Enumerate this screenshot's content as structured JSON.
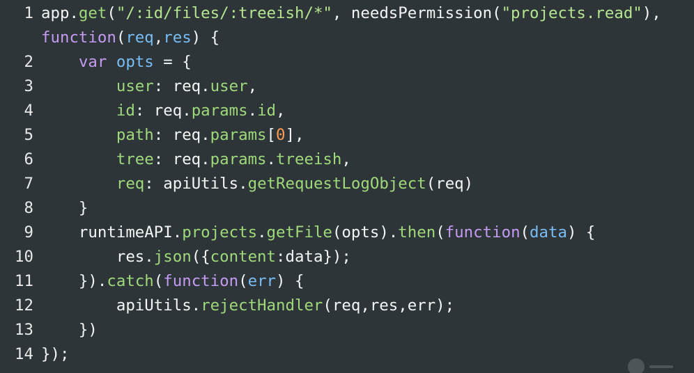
{
  "editor": {
    "lines": [
      {
        "number": "1",
        "tokens": [
          {
            "text": "app.",
            "kind": "plain"
          },
          {
            "text": "get",
            "kind": "prop"
          },
          {
            "text": "(",
            "kind": "plain"
          },
          {
            "text": "\"/:id/files/:treeish/*\"",
            "kind": "str"
          },
          {
            "text": ", needsPermission(",
            "kind": "plain"
          },
          {
            "text": "\"projects.read\"",
            "kind": "str"
          },
          {
            "text": "),",
            "kind": "plain"
          }
        ]
      },
      {
        "number": "",
        "tokens": [
          {
            "text": "function",
            "kind": "kw"
          },
          {
            "text": "(",
            "kind": "plain"
          },
          {
            "text": "req",
            "kind": "var"
          },
          {
            "text": ",",
            "kind": "plain"
          },
          {
            "text": "res",
            "kind": "var"
          },
          {
            "text": ") {",
            "kind": "plain"
          }
        ]
      },
      {
        "number": "2",
        "tokens": [
          {
            "text": "    ",
            "kind": "plain"
          },
          {
            "text": "var",
            "kind": "kw"
          },
          {
            "text": " ",
            "kind": "plain"
          },
          {
            "text": "opts",
            "kind": "var"
          },
          {
            "text": " = {",
            "kind": "plain"
          }
        ]
      },
      {
        "number": "3",
        "tokens": [
          {
            "text": "        ",
            "kind": "plain"
          },
          {
            "text": "user",
            "kind": "prop"
          },
          {
            "text": ": req.",
            "kind": "plain"
          },
          {
            "text": "user",
            "kind": "prop"
          },
          {
            "text": ",",
            "kind": "plain"
          }
        ]
      },
      {
        "number": "4",
        "tokens": [
          {
            "text": "        ",
            "kind": "plain"
          },
          {
            "text": "id",
            "kind": "prop"
          },
          {
            "text": ": req.",
            "kind": "plain"
          },
          {
            "text": "params",
            "kind": "prop"
          },
          {
            "text": ".",
            "kind": "plain"
          },
          {
            "text": "id",
            "kind": "prop"
          },
          {
            "text": ",",
            "kind": "plain"
          }
        ]
      },
      {
        "number": "5",
        "tokens": [
          {
            "text": "        ",
            "kind": "plain"
          },
          {
            "text": "path",
            "kind": "prop"
          },
          {
            "text": ": req.",
            "kind": "plain"
          },
          {
            "text": "params",
            "kind": "prop"
          },
          {
            "text": "[",
            "kind": "plain"
          },
          {
            "text": "0",
            "kind": "num"
          },
          {
            "text": "],",
            "kind": "plain"
          }
        ]
      },
      {
        "number": "6",
        "tokens": [
          {
            "text": "        ",
            "kind": "plain"
          },
          {
            "text": "tree",
            "kind": "prop"
          },
          {
            "text": ": req.",
            "kind": "plain"
          },
          {
            "text": "params",
            "kind": "prop"
          },
          {
            "text": ".",
            "kind": "plain"
          },
          {
            "text": "treeish",
            "kind": "prop"
          },
          {
            "text": ",",
            "kind": "plain"
          }
        ]
      },
      {
        "number": "7",
        "tokens": [
          {
            "text": "        ",
            "kind": "plain"
          },
          {
            "text": "req",
            "kind": "prop"
          },
          {
            "text": ": apiUtils.",
            "kind": "plain"
          },
          {
            "text": "getRequestLogObject",
            "kind": "prop"
          },
          {
            "text": "(req)",
            "kind": "plain"
          }
        ]
      },
      {
        "number": "8",
        "tokens": [
          {
            "text": "    }",
            "kind": "plain"
          }
        ]
      },
      {
        "number": "9",
        "tokens": [
          {
            "text": "    runtimeAPI.",
            "kind": "plain"
          },
          {
            "text": "projects",
            "kind": "prop"
          },
          {
            "text": ".",
            "kind": "plain"
          },
          {
            "text": "getFile",
            "kind": "prop"
          },
          {
            "text": "(opts).",
            "kind": "plain"
          },
          {
            "text": "then",
            "kind": "prop"
          },
          {
            "text": "(",
            "kind": "plain"
          },
          {
            "text": "function",
            "kind": "kw"
          },
          {
            "text": "(",
            "kind": "plain"
          },
          {
            "text": "data",
            "kind": "var"
          },
          {
            "text": ") {",
            "kind": "plain"
          }
        ]
      },
      {
        "number": "10",
        "tokens": [
          {
            "text": "        res.",
            "kind": "plain"
          },
          {
            "text": "json",
            "kind": "prop"
          },
          {
            "text": "({",
            "kind": "plain"
          },
          {
            "text": "content",
            "kind": "prop"
          },
          {
            "text": ":data});",
            "kind": "plain"
          }
        ]
      },
      {
        "number": "11",
        "tokens": [
          {
            "text": "    }).",
            "kind": "plain"
          },
          {
            "text": "catch",
            "kind": "prop"
          },
          {
            "text": "(",
            "kind": "plain"
          },
          {
            "text": "function",
            "kind": "kw"
          },
          {
            "text": "(",
            "kind": "plain"
          },
          {
            "text": "err",
            "kind": "var"
          },
          {
            "text": ") {",
            "kind": "plain"
          }
        ]
      },
      {
        "number": "12",
        "tokens": [
          {
            "text": "        apiUtils.",
            "kind": "plain"
          },
          {
            "text": "rejectHandler",
            "kind": "prop"
          },
          {
            "text": "(req,res,err);",
            "kind": "plain"
          }
        ]
      },
      {
        "number": "13",
        "tokens": [
          {
            "text": "    })",
            "kind": "plain"
          }
        ]
      },
      {
        "number": "14",
        "tokens": [
          {
            "text": "});",
            "kind": "plain"
          }
        ]
      }
    ],
    "colors": {
      "background": "#2d3539",
      "plain_text": "#f4f6f6",
      "line_number": "#e8eaea",
      "property": "#9fd97a",
      "string": "#b6e58f",
      "keyword": "#c59bf2",
      "variable": "#79bdf5",
      "number": "#ff9b54"
    },
    "overlay_icon": "watermark-badge-icon"
  }
}
